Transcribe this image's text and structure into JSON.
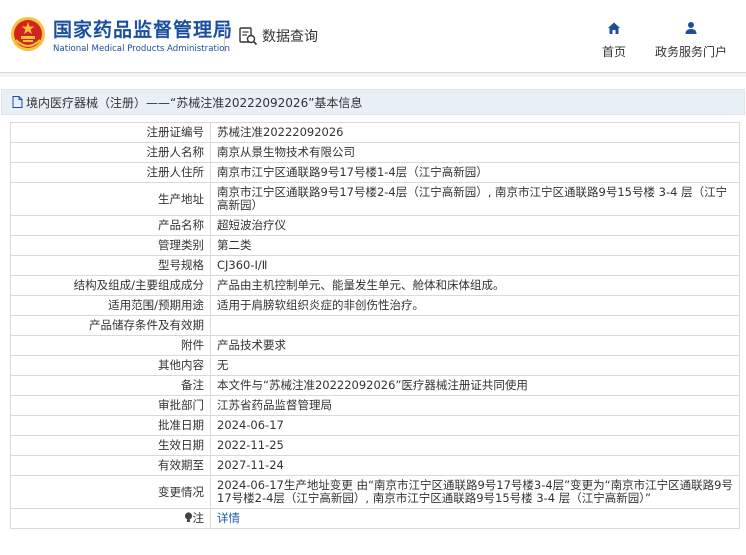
{
  "header": {
    "agency_cn": "国家药品监督管理局",
    "agency_en": "National Medical Products Administration",
    "query_label": "数据查询",
    "nav": [
      {
        "label": "首页",
        "icon": "home-icon"
      },
      {
        "label": "政务服务门户",
        "icon": "user-icon"
      }
    ]
  },
  "breadcrumb": {
    "text": "境内医疗器械（注册）——“苏械注准20222092026”基本信息"
  },
  "rows": [
    {
      "key": "注册证编号",
      "value": "苏械注准20222092026"
    },
    {
      "key": "注册人名称",
      "value": "南京从景生物技术有限公司"
    },
    {
      "key": "注册人住所",
      "value": "南京市江宁区通联路9号17号楼1-4层（江宁高新园）"
    },
    {
      "key": "生产地址",
      "value": "南京市江宁区通联路9号17号楼2-4层（江宁高新园）, 南京市江宁区通联路9号15号楼 3-4 层（江宁高新园）"
    },
    {
      "key": "产品名称",
      "value": "超短波治疗仪"
    },
    {
      "key": "管理类别",
      "value": "第二类"
    },
    {
      "key": "型号规格",
      "value": "CJ360-Ⅰ/Ⅱ"
    },
    {
      "key": "结构及组成/主要组成成分",
      "value": "产品由主机控制单元、能量发生单元、舱体和床体组成。"
    },
    {
      "key": "适用范围/预期用途",
      "value": "适用于肩膀软组织炎症的非创伤性治疗。"
    },
    {
      "key": "产品储存条件及有效期",
      "value": ""
    },
    {
      "key": "附件",
      "value": "产品技术要求"
    },
    {
      "key": "其他内容",
      "value": "无"
    },
    {
      "key": "备注",
      "value": "本文件与“苏械注准20222092026”医疗器械注册证共同使用"
    },
    {
      "key": "审批部门",
      "value": "江苏省药品监督管理局"
    },
    {
      "key": "批准日期",
      "value": "2024-06-17"
    },
    {
      "key": "生效日期",
      "value": "2022-11-25"
    },
    {
      "key": "有效期至",
      "value": "2027-11-24"
    },
    {
      "key": "变更情况",
      "value": "2024-06-17生产地址变更 由“南京市江宁区通联路9号17号楼3-4层”变更为“南京市江宁区通联路9号17号楼2-4层（江宁高新园）, 南京市江宁区通联路9号15号楼 3-4 层（江宁高新园）”"
    },
    {
      "key": "注",
      "value": "详情",
      "key_icon": "bulb-icon"
    }
  ],
  "colors": {
    "brand_blue": "#1b4fa0",
    "emblem_red": "#d2231c",
    "emblem_gold": "#f3c43b",
    "link_blue": "#1a5aa6",
    "breadcrumb_bg": "#e9eff6"
  }
}
